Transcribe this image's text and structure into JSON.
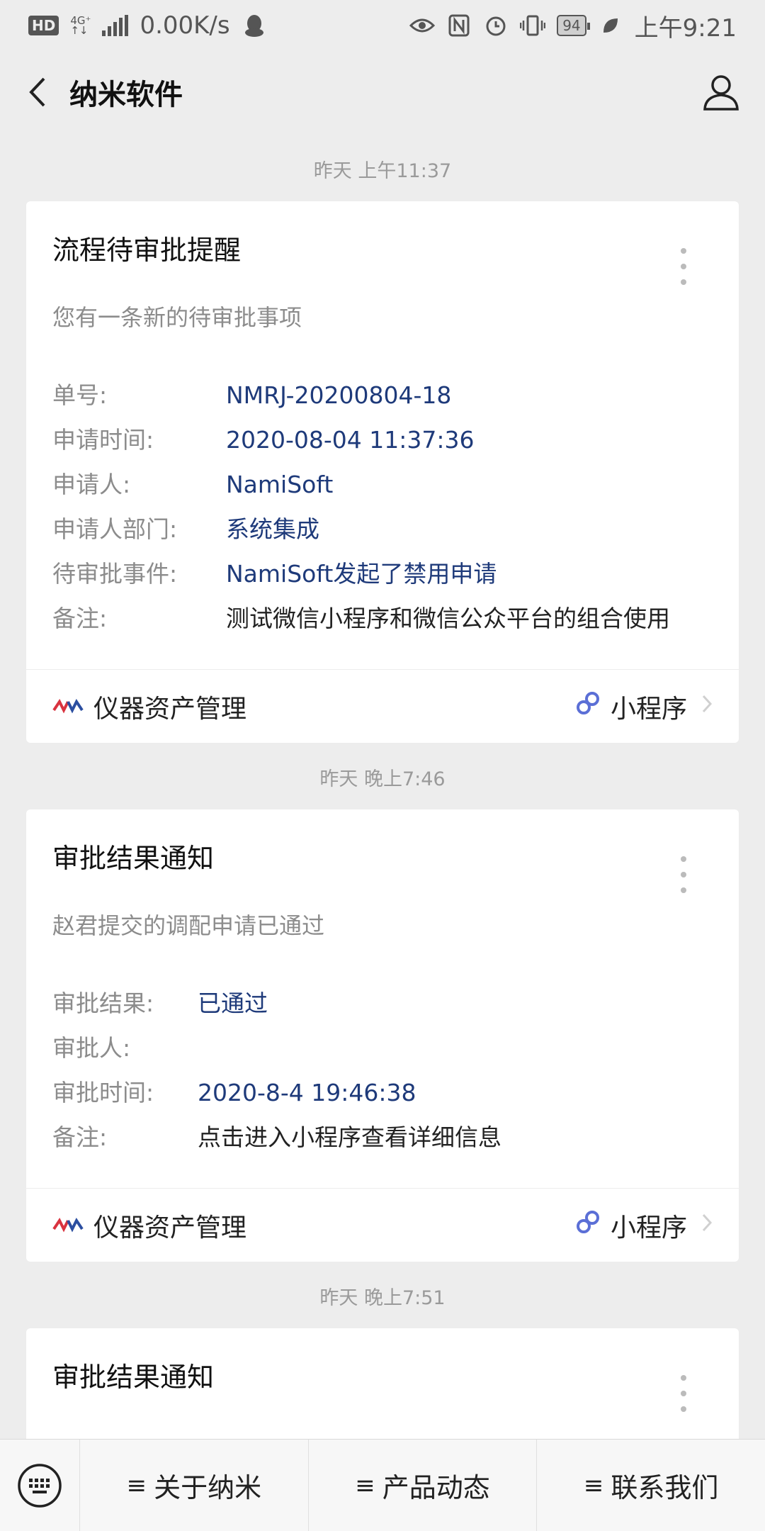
{
  "status_bar": {
    "hd": "HD",
    "network": "4G⁺",
    "network_sub": "↑↓",
    "speed": "0.00K/s",
    "battery": "94",
    "time": "上午9:21"
  },
  "header": {
    "title": "纳米软件"
  },
  "messages": [
    {
      "timestamp": "昨天 上午11:37",
      "title": "流程待审批提醒",
      "description": "您有一条新的待审批事项",
      "fields": [
        {
          "label": "单号:",
          "value": "NMRJ-20200804-18"
        },
        {
          "label": "申请时间:",
          "value": "2020-08-04 11:37:36"
        },
        {
          "label": "申请人:",
          "value": "NamiSoft"
        },
        {
          "label": "申请人部门:",
          "value": "系统集成"
        },
        {
          "label": "待审批事件:",
          "value": "NamiSoft发起了禁用申请"
        },
        {
          "label": "备注:",
          "value": "测试微信小程序和微信公众平台的组合使用"
        }
      ],
      "app_name": "仪器资产管理",
      "mini_program_label": "小程序"
    },
    {
      "timestamp": "昨天 晚上7:46",
      "title": "审批结果通知",
      "description": "赵君提交的调配申请已通过",
      "fields": [
        {
          "label": "审批结果:",
          "value": "已通过"
        },
        {
          "label": "审批人:",
          "value": ""
        },
        {
          "label": "审批时间:",
          "value": "2020-8-4 19:46:38"
        },
        {
          "label": "备注:",
          "value": "点击进入小程序查看详细信息"
        }
      ],
      "app_name": "仪器资产管理",
      "mini_program_label": "小程序"
    },
    {
      "timestamp": "昨天 晚上7:51",
      "title": "审批结果通知"
    }
  ],
  "bottom_menu": {
    "items": [
      "关于纳米",
      "产品动态",
      "联系我们"
    ],
    "marker": "≡"
  },
  "colors": {
    "background": "#ededed",
    "card": "#ffffff",
    "value_link": "#1e3a7a",
    "label_gray": "#8c8c8c",
    "mini_program_icon": "#5b6fd6",
    "brand_red": "#d9333f",
    "brand_blue": "#2b4ea0"
  }
}
